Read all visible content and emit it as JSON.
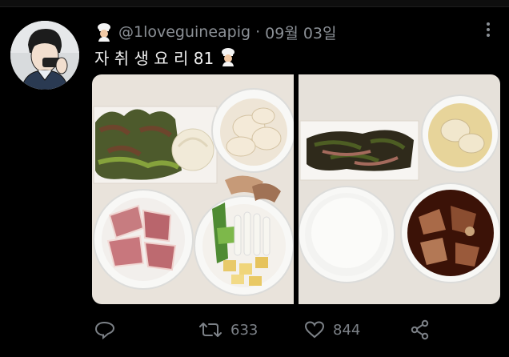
{
  "tweet": {
    "handle": "@1loveguineapig",
    "separator": "·",
    "date": "09월 03일",
    "text": "자 취 생 요 리 81",
    "author_emoji": "chef-emoji",
    "text_emoji": "chef-emoji"
  },
  "media": {
    "left_photo": "meal-ingredients-photo",
    "right_photo": "cooked-meal-photo"
  },
  "actions": {
    "reply_icon": "reply-icon",
    "retweet_icon": "retweet-icon",
    "retweet_count": "633",
    "like_icon": "heart-icon",
    "like_count": "844",
    "share_icon": "share-icon"
  },
  "more_icon": "more-vertical-icon"
}
